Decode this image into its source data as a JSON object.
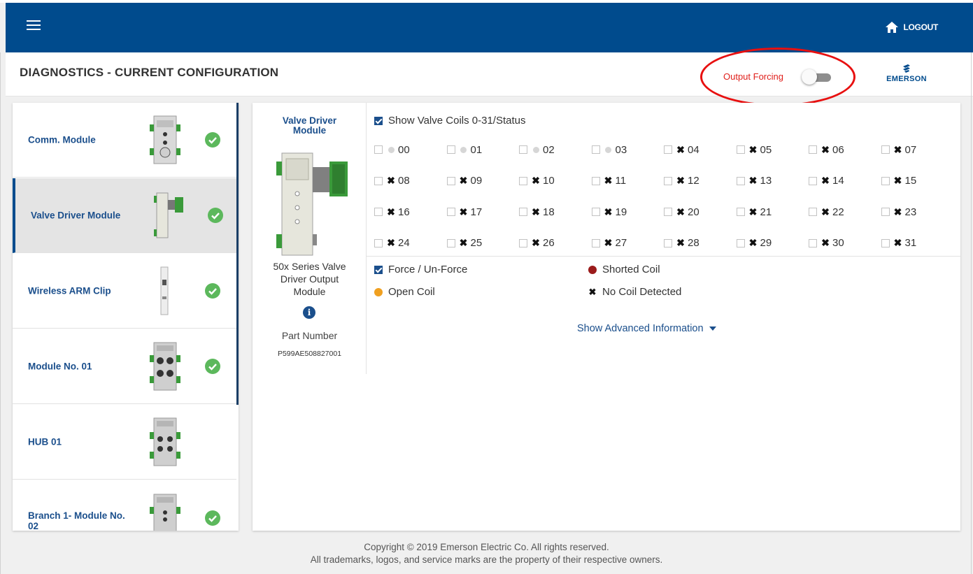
{
  "topbar": {
    "menu_icon": "hamburger-icon",
    "logout_icon": "home-icon",
    "logout_label": "LOGOUT"
  },
  "header": {
    "title": "DIAGNOSTICS - CURRENT CONFIGURATION",
    "output_forcing_label": "Output Forcing",
    "output_forcing_on": false,
    "logo_text": "EMERSON"
  },
  "sidebar": {
    "items": [
      {
        "label": "Comm. Module",
        "status": "ok"
      },
      {
        "label": "Valve Driver Module",
        "status": "ok",
        "active": true
      },
      {
        "label": "Wireless ARM Clip",
        "status": "ok"
      },
      {
        "label": "Module No. 01",
        "status": "ok"
      },
      {
        "label": "HUB 01"
      },
      {
        "label": "Branch 1- Module No. 02",
        "status": "ok"
      }
    ]
  },
  "module": {
    "title": "Valve Driver Module",
    "description": "50x Series Valve Driver Output Module",
    "part_number_label": "Part Number",
    "part_number": "P599AE508827001"
  },
  "coils": {
    "show_label": "Show Valve Coils 0-31/Status",
    "show_checked": true,
    "items": [
      {
        "num": "00",
        "state": "ok"
      },
      {
        "num": "01",
        "state": "ok"
      },
      {
        "num": "02",
        "state": "ok"
      },
      {
        "num": "03",
        "state": "ok"
      },
      {
        "num": "04",
        "state": "none"
      },
      {
        "num": "05",
        "state": "none"
      },
      {
        "num": "06",
        "state": "none"
      },
      {
        "num": "07",
        "state": "none"
      },
      {
        "num": "08",
        "state": "none"
      },
      {
        "num": "09",
        "state": "none"
      },
      {
        "num": "10",
        "state": "none"
      },
      {
        "num": "11",
        "state": "none"
      },
      {
        "num": "12",
        "state": "none"
      },
      {
        "num": "13",
        "state": "none"
      },
      {
        "num": "14",
        "state": "none"
      },
      {
        "num": "15",
        "state": "none"
      },
      {
        "num": "16",
        "state": "none"
      },
      {
        "num": "17",
        "state": "none"
      },
      {
        "num": "18",
        "state": "none"
      },
      {
        "num": "19",
        "state": "none"
      },
      {
        "num": "20",
        "state": "none"
      },
      {
        "num": "21",
        "state": "none"
      },
      {
        "num": "22",
        "state": "none"
      },
      {
        "num": "23",
        "state": "none"
      },
      {
        "num": "24",
        "state": "none"
      },
      {
        "num": "25",
        "state": "none"
      },
      {
        "num": "26",
        "state": "none"
      },
      {
        "num": "27",
        "state": "none"
      },
      {
        "num": "28",
        "state": "none"
      },
      {
        "num": "29",
        "state": "none"
      },
      {
        "num": "30",
        "state": "none"
      },
      {
        "num": "31",
        "state": "none"
      }
    ]
  },
  "legend": {
    "force_label": "Force / Un-Force",
    "force_checked": true,
    "shorted_label": "Shorted Coil",
    "shorted_color": "#9b1b1b",
    "open_label": "Open Coil",
    "open_color": "#f0a020",
    "nocoil_label": "No Coil Detected",
    "nocoil_symbol": "✖"
  },
  "advanced_label": "Show Advanced Information",
  "footer": {
    "line1": "Copyright © 2019 Emerson Electric Co. All rights reserved.",
    "line2": "All trademarks, logos, and service marks are the property of their respective owners."
  },
  "colors": {
    "brand_blue": "#004b8d",
    "link_blue": "#1b4f8c",
    "success_green": "#5cb85c",
    "alert_red": "#e0201c"
  }
}
